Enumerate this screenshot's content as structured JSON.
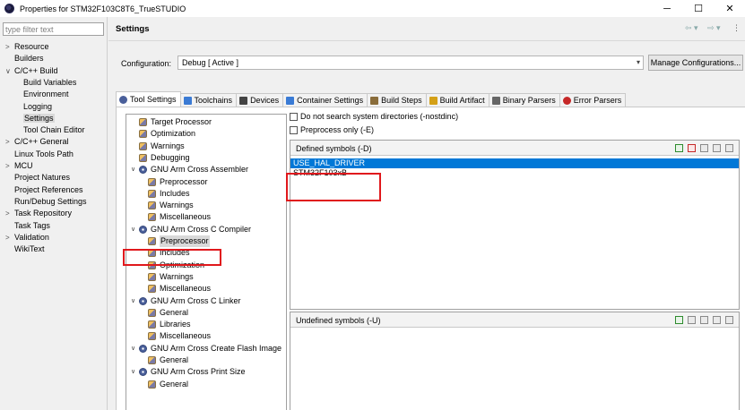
{
  "window": {
    "title": "Properties for STM32F103C8T6_TrueSTUDIO",
    "minimize": "─",
    "maximize": "☐",
    "close": "✕"
  },
  "filter": {
    "placeholder": "type filter text"
  },
  "nav": [
    {
      "label": "Resource",
      "twisty": ">",
      "indent": 0
    },
    {
      "label": "Builders",
      "twisty": "",
      "indent": 0
    },
    {
      "label": "C/C++ Build",
      "twisty": "v",
      "indent": 0
    },
    {
      "label": "Build Variables",
      "twisty": "",
      "indent": 1
    },
    {
      "label": "Environment",
      "twisty": "",
      "indent": 1
    },
    {
      "label": "Logging",
      "twisty": "",
      "indent": 1
    },
    {
      "label": "Settings",
      "twisty": "",
      "indent": 1,
      "selected": true
    },
    {
      "label": "Tool Chain Editor",
      "twisty": "",
      "indent": 1
    },
    {
      "label": "C/C++ General",
      "twisty": ">",
      "indent": 0
    },
    {
      "label": "Linux Tools Path",
      "twisty": "",
      "indent": 0
    },
    {
      "label": "MCU",
      "twisty": ">",
      "indent": 0
    },
    {
      "label": "Project Natures",
      "twisty": "",
      "indent": 0
    },
    {
      "label": "Project References",
      "twisty": "",
      "indent": 0
    },
    {
      "label": "Run/Debug Settings",
      "twisty": "",
      "indent": 0
    },
    {
      "label": "Task Repository",
      "twisty": ">",
      "indent": 0
    },
    {
      "label": "Task Tags",
      "twisty": "",
      "indent": 0
    },
    {
      "label": "Validation",
      "twisty": ">",
      "indent": 0
    },
    {
      "label": "WikiText",
      "twisty": "",
      "indent": 0
    }
  ],
  "header": {
    "title": "Settings",
    "back": "⇦ ▾",
    "forward": "⇨ ▾",
    "menu": "⋮"
  },
  "configuration": {
    "label": "Configuration:",
    "value": "Debug  [ Active ]",
    "manage_button": "Manage Configurations..."
  },
  "tabs": [
    {
      "label": "Tool Settings",
      "icon": "gear-icon",
      "active": true
    },
    {
      "label": "Toolchains",
      "icon": "toolchain-icon"
    },
    {
      "label": "Devices",
      "icon": "device-icon"
    },
    {
      "label": "Container Settings",
      "icon": "container-icon"
    },
    {
      "label": "Build Steps",
      "icon": "wrench-icon"
    },
    {
      "label": "Build Artifact",
      "icon": "artifact-icon"
    },
    {
      "label": "Binary Parsers",
      "icon": "binary-icon"
    },
    {
      "label": "Error Parsers",
      "icon": "error-icon"
    }
  ],
  "tool_tree": [
    {
      "label": "Target Processor",
      "level": 0,
      "kind": "opt"
    },
    {
      "label": "Optimization",
      "level": 0,
      "kind": "opt"
    },
    {
      "label": "Warnings",
      "level": 0,
      "kind": "opt"
    },
    {
      "label": "Debugging",
      "level": 0,
      "kind": "opt"
    },
    {
      "label": "GNU Arm Cross Assembler",
      "level": 0,
      "kind": "tool"
    },
    {
      "label": "Preprocessor",
      "level": 1,
      "kind": "opt"
    },
    {
      "label": "Includes",
      "level": 1,
      "kind": "opt"
    },
    {
      "label": "Warnings",
      "level": 1,
      "kind": "opt"
    },
    {
      "label": "Miscellaneous",
      "level": 1,
      "kind": "opt"
    },
    {
      "label": "GNU Arm Cross C Compiler",
      "level": 0,
      "kind": "tool"
    },
    {
      "label": "Preprocessor",
      "level": 1,
      "kind": "opt",
      "selected": true
    },
    {
      "label": "Includes",
      "level": 1,
      "kind": "opt"
    },
    {
      "label": "Optimization",
      "level": 1,
      "kind": "opt"
    },
    {
      "label": "Warnings",
      "level": 1,
      "kind": "opt"
    },
    {
      "label": "Miscellaneous",
      "level": 1,
      "kind": "opt"
    },
    {
      "label": "GNU Arm Cross C Linker",
      "level": 0,
      "kind": "tool"
    },
    {
      "label": "General",
      "level": 1,
      "kind": "opt"
    },
    {
      "label": "Libraries",
      "level": 1,
      "kind": "opt"
    },
    {
      "label": "Miscellaneous",
      "level": 1,
      "kind": "opt"
    },
    {
      "label": "GNU Arm Cross Create Flash Image",
      "level": 0,
      "kind": "tool"
    },
    {
      "label": "General",
      "level": 1,
      "kind": "opt"
    },
    {
      "label": "GNU Arm Cross Print Size",
      "level": 0,
      "kind": "tool"
    },
    {
      "label": "General",
      "level": 1,
      "kind": "opt"
    }
  ],
  "options": {
    "nostdinc": "Do not search system directories (-nostdinc)",
    "preprocess_only": "Preprocess only (-E)"
  },
  "defined_symbols": {
    "title": "Defined symbols (-D)",
    "items": [
      "USE_HAL_DRIVER",
      "STM32F103xB"
    ]
  },
  "undefined_symbols": {
    "title": "Undefined symbols (-U)",
    "items": []
  },
  "colors": {
    "selection": "#0078d7",
    "highlight_box": "#e0181c"
  }
}
